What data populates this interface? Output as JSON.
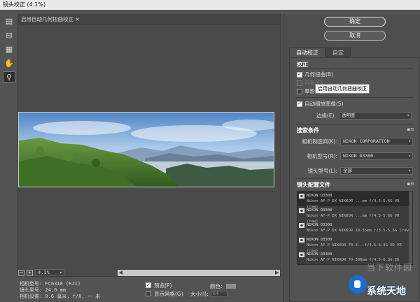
{
  "window": {
    "title": "镜头校正 (4.1%)"
  },
  "toolbar": {
    "tools": [
      {
        "name": "remove-distortion-tool-icon",
        "glyph": "▤"
      },
      {
        "name": "straighten-tool-icon",
        "glyph": "⊟"
      },
      {
        "name": "move-grid-tool-icon",
        "glyph": "▦"
      },
      {
        "name": "hand-tool-icon",
        "glyph": "✋"
      },
      {
        "name": "zoom-tool-icon",
        "glyph": "⚲"
      }
    ],
    "selected_index": 4
  },
  "preview": {
    "header_text": "启用自动几何扭曲校正",
    "header_close": "×",
    "zoom_minus": "−",
    "zoom_plus": "+",
    "zoom_value": "4.1%",
    "zoom_caret": "▾"
  },
  "camera_meta": {
    "line1": "相机型号: FC6310 (RJI)",
    "line2": "镜头型号: 24.0 mm",
    "line3": "相机设置: 0.6 毫米, f/8, 一 米"
  },
  "bottom_options": {
    "preview_label": "预览(P)",
    "preview_checked": true,
    "show_grid_label": "显示网格(G)",
    "show_grid_checked": false,
    "color_label": "颜色:",
    "size_label": "大小(I):",
    "size_value": "64"
  },
  "buttons": {
    "ok": "确定",
    "cancel": "取消"
  },
  "tabs": [
    {
      "label": "自动校正",
      "active": true
    },
    {
      "label": "自定",
      "active": false
    }
  ],
  "correction": {
    "title": "校正",
    "items": [
      {
        "label": "几何扭曲(B)",
        "checked": true,
        "dim": false
      },
      {
        "label": "色差(C)",
        "checked": false,
        "dim": true
      },
      {
        "label": "晕影(V)",
        "checked": false,
        "dim": false
      }
    ],
    "auto_scale_label": "自动缩放图像(S)",
    "auto_scale_checked": true,
    "edge_label": "边缘(E):",
    "edge_value": "透明度"
  },
  "tooltip": "启用自动几何扭曲校正",
  "search": {
    "title": "搜索条件",
    "maker_label": "相机制造商(K):",
    "maker_value": "NIKON CORPORATION",
    "model_label": "相机型号(R):",
    "model_value": "NIKON D3300",
    "lens_label": "镜头型号(L):",
    "lens_value": "全部"
  },
  "profiles": {
    "title": "镜头配置文件",
    "items": [
      {
        "camera": "NIKON D3300",
        "lens": "Nikon AF-P DX NIKKOR ...mm f/4.5-5.6G VR (raw)"
      },
      {
        "camera": "NIKON D3300",
        "lens": "Nikon AF-P DX NIKKOR ...mm f/4.5-5.6G VR (raw)"
      },
      {
        "camera": "NIKON D3300",
        "lens": "Nikon AF-P DX NIKKOR 18-55mm f/3.5-5.6G (raw)"
      },
      {
        "camera": "NIKON D3300",
        "lens": "Nikon AF-P NIKKOR 70-3...f/4.5-6.3G ED VR (raw)"
      },
      {
        "camera": "NIKON D3300",
        "lens": "Nikon AF-P NIKKOR 70-300mm f/4.5-6.3G ED (raw)"
      }
    ]
  },
  "menu_icon": "▪≡",
  "watermark": {
    "text1": "当下软件园",
    "text2": "系统天地"
  }
}
